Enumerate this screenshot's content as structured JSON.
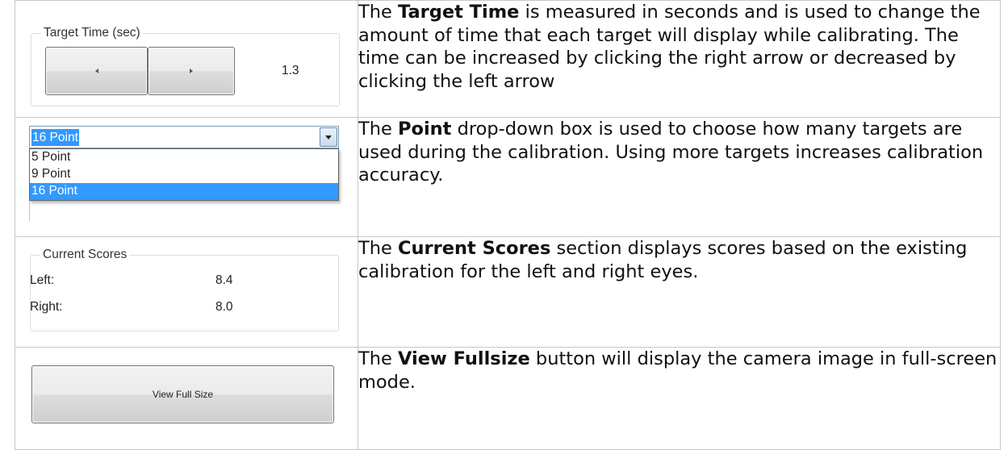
{
  "rows": [
    {
      "ui": {
        "group_title": "Target Time (sec)",
        "value": "1.3"
      },
      "desc": {
        "pre": "The ",
        "bold": "Target Time",
        "post": " is measured in seconds and is used to change the amount of time that each target will display while calibrating.  The time can be increased by clicking the right arrow or decreased by clicking the left arrow"
      }
    },
    {
      "ui": {
        "selected_value": "16 Point",
        "options": [
          "5 Point",
          "9 Point",
          "16 Point"
        ]
      },
      "desc": {
        "pre": "The ",
        "bold": "Point",
        "post": " drop-down box is used to choose how many targets are used during the calibration.  Using more targets increases calibration accuracy."
      }
    },
    {
      "ui": {
        "group_title": "Current Scores",
        "left_label": "Left:",
        "left_value": "8.4",
        "right_label": "Right:",
        "right_value": "8.0"
      },
      "desc": {
        "pre": "The ",
        "bold": "Current Scores",
        "post": " section displays scores based on the existing calibration for the left and right eyes."
      }
    },
    {
      "ui": {
        "button_label": "View Full Size"
      },
      "desc": {
        "pre": "The ",
        "bold": "View Fullsize",
        "post": " button will display the camera image in full-screen mode."
      }
    }
  ],
  "icons": {
    "decrease": "left-arrow-icon",
    "increase": "right-arrow-icon",
    "dropdown": "chevron-down-icon"
  }
}
